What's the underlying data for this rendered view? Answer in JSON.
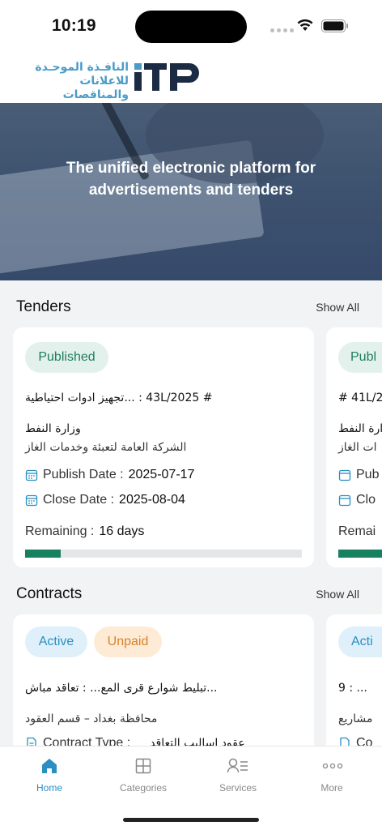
{
  "status": {
    "time": "10:19"
  },
  "header": {
    "logo_ar_line1": "النافـذة الموحـدة",
    "logo_ar_line2": "للاعلانات والمناقصات",
    "logo_en": "ITP"
  },
  "hero": {
    "title": "The unified electronic platform for advertisements and tenders"
  },
  "tenders": {
    "title": "Tenders",
    "show_all": "Show All",
    "items": [
      {
        "status": "Published",
        "number_line": "# 43L/2025 : ...تجهيز ادوات احتياطية",
        "ministry": "وزارة النفط",
        "company": "الشركة العامة لتعبئة وخدمات الغاز",
        "publish_label": "Publish Date :",
        "publish_date": "2025-07-17",
        "close_label": "Close Date :",
        "close_date": "2025-08-04",
        "remaining_label": "Remaining :",
        "remaining_value": "16 days",
        "progress": 0.13
      },
      {
        "status": "Publ",
        "number_line": "# 41L/2",
        "ministry": "وزارة النفط",
        "company": "ات الغاز",
        "publish_label": "Pub",
        "close_label": "Clo",
        "remaining_label": "Remai"
      }
    ]
  },
  "contracts": {
    "title": "Contracts",
    "show_all": "Show All",
    "items": [
      {
        "badge1": "Active",
        "badge2": "Unpaid",
        "title_line": "...تبليط شوارع قرى المع... : تعاقد مباش",
        "org": "محافظة بغداد – قسم العقود",
        "type_label": "Contract Type :",
        "type_value": "عقود اساليب التعاقد"
      },
      {
        "badge1": "Acti",
        "title_line": "9 : ...",
        "org": "مشاريع",
        "type_label": "Co"
      }
    ]
  },
  "tabbar": {
    "items": [
      {
        "label": "Home",
        "icon": "home-icon",
        "active": true
      },
      {
        "label": "Categories",
        "icon": "grid-icon"
      },
      {
        "label": "Services",
        "icon": "person-list-icon"
      },
      {
        "label": "More",
        "icon": "more-dots-icon"
      }
    ]
  },
  "colors": {
    "brand_blue": "#2b8fc1",
    "brand_green": "#17805f",
    "orange": "#d9822b"
  }
}
